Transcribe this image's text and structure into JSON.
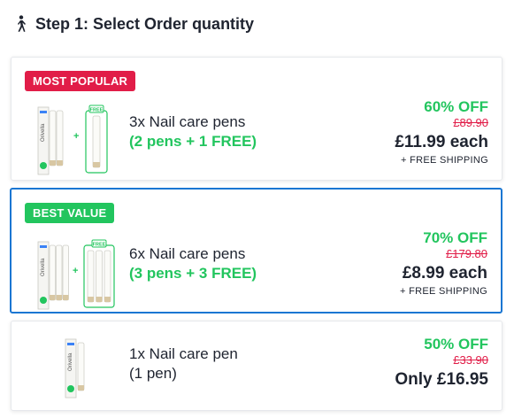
{
  "header": {
    "title": "Step 1: Select Order quantity",
    "icon": "walking-person-icon"
  },
  "offers": [
    {
      "badge": "MOST POPULAR",
      "badge_color": "#e11d48",
      "product_label": "3x Nail care pens",
      "product_sub": "(2 pens + 1 FREE)",
      "free_tag": "FREE",
      "discount": "60% OFF",
      "original_price": "£89.90",
      "price": "£11.99 each",
      "shipping": "+ FREE SHIPPING",
      "selected": false
    },
    {
      "badge": "BEST VALUE",
      "badge_color": "#22c55e",
      "product_label": "6x Nail care pens",
      "product_sub": "(3 pens + 3 FREE)",
      "free_tag": "FREE",
      "discount": "70% OFF",
      "original_price": "£179.80",
      "price": "£8.99 each",
      "shipping": "+ FREE SHIPPING",
      "selected": true
    },
    {
      "product_label": "1x Nail care pen",
      "product_sub": "(1 pen)",
      "discount": "50% OFF",
      "original_price": "£33.90",
      "price": "Only £16.95",
      "selected": false
    }
  ],
  "product_brand": "Orivella",
  "colors": {
    "accent_green": "#22c55e",
    "accent_red": "#e11d48",
    "selected_border": "#1976d2"
  }
}
